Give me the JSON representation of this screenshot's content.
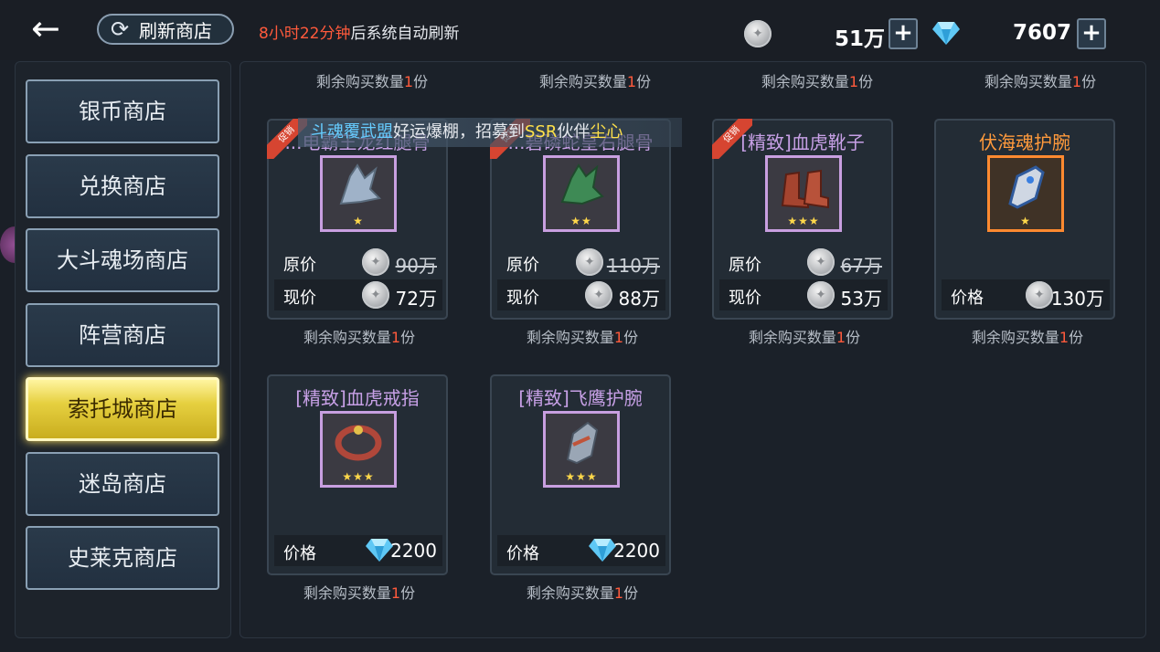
{
  "header": {
    "back_glyph": "←",
    "refresh_label": "刷新商店",
    "timer_red": "8小时22分钟",
    "timer_rest": "后系统自动刷新",
    "silver": "51万",
    "diamond": "7607",
    "plus": "+"
  },
  "nav": [
    "银币商店",
    "兑换商店",
    "大斗魂场商店",
    "阵营商店",
    "索托城商店",
    "迷岛商店",
    "史莱克商店"
  ],
  "active_nav": "索托城商店",
  "banner": {
    "p1": "斗魂",
    "p2": "覆武盟",
    "p3": "好运爆棚，招募到",
    "p4": "SSR",
    "p5": "伙伴",
    "p6": "尘心"
  },
  "remain": {
    "prefix": "剩余购买数量",
    "count": "1",
    "suffix": "份"
  },
  "ribbon": "促销",
  "labels": {
    "orig": "原价",
    "now": "现价",
    "price": "价格"
  },
  "items": [
    {
      "title": "...电霸王龙红腿骨",
      "stars": "★",
      "orig": "90万",
      "now": "72万"
    },
    {
      "title": "...碧磷蛇皇右腿骨",
      "stars": "★★",
      "orig": "110万",
      "now": "88万"
    },
    {
      "title": "[精致]血虎靴子",
      "stars": "★★★",
      "orig": "67万",
      "now": "53万"
    },
    {
      "title": "伏海魂护腕",
      "stars": "★",
      "price": "130万"
    },
    {
      "title": "[精致]血虎戒指",
      "stars": "★★★",
      "price": "2200"
    },
    {
      "title": "[精致]飞鹰护腕",
      "stars": "★★★",
      "price": "2200"
    }
  ],
  "colors": {
    "accent_gold": "#e6d040",
    "remain_red": "#ff5a3c",
    "epic_purple": "#c89fe0",
    "legend_orange": "#ff8a30"
  }
}
